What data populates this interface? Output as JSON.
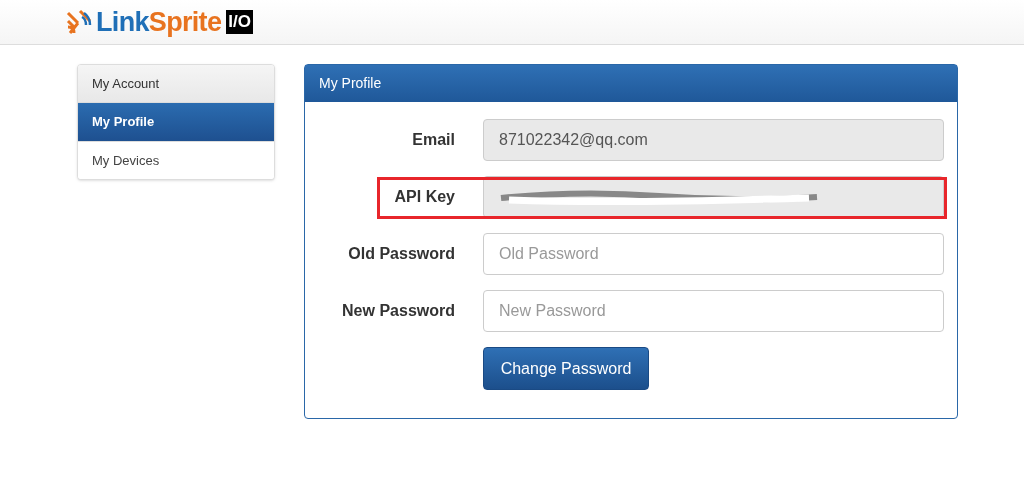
{
  "header": {
    "logo": {
      "parts": [
        "Link",
        "Sprite"
      ],
      "badge": "I/O"
    }
  },
  "sidebar": {
    "title": "My Account",
    "items": [
      {
        "label": "My Profile",
        "selected": true
      },
      {
        "label": "My Devices",
        "selected": false
      }
    ]
  },
  "panel": {
    "title": "My Profile",
    "fields": [
      {
        "label": "Email",
        "kind": "readonly",
        "value": "871022342@qq.com",
        "highlighted": false
      },
      {
        "label": "API Key",
        "kind": "redacted",
        "highlighted": true
      },
      {
        "label": "Old Password",
        "kind": "input",
        "placeholder": "Old Password",
        "highlighted": false
      },
      {
        "label": "New Password",
        "kind": "input",
        "placeholder": "New Password",
        "highlighted": false
      }
    ],
    "button": "Change Password"
  }
}
